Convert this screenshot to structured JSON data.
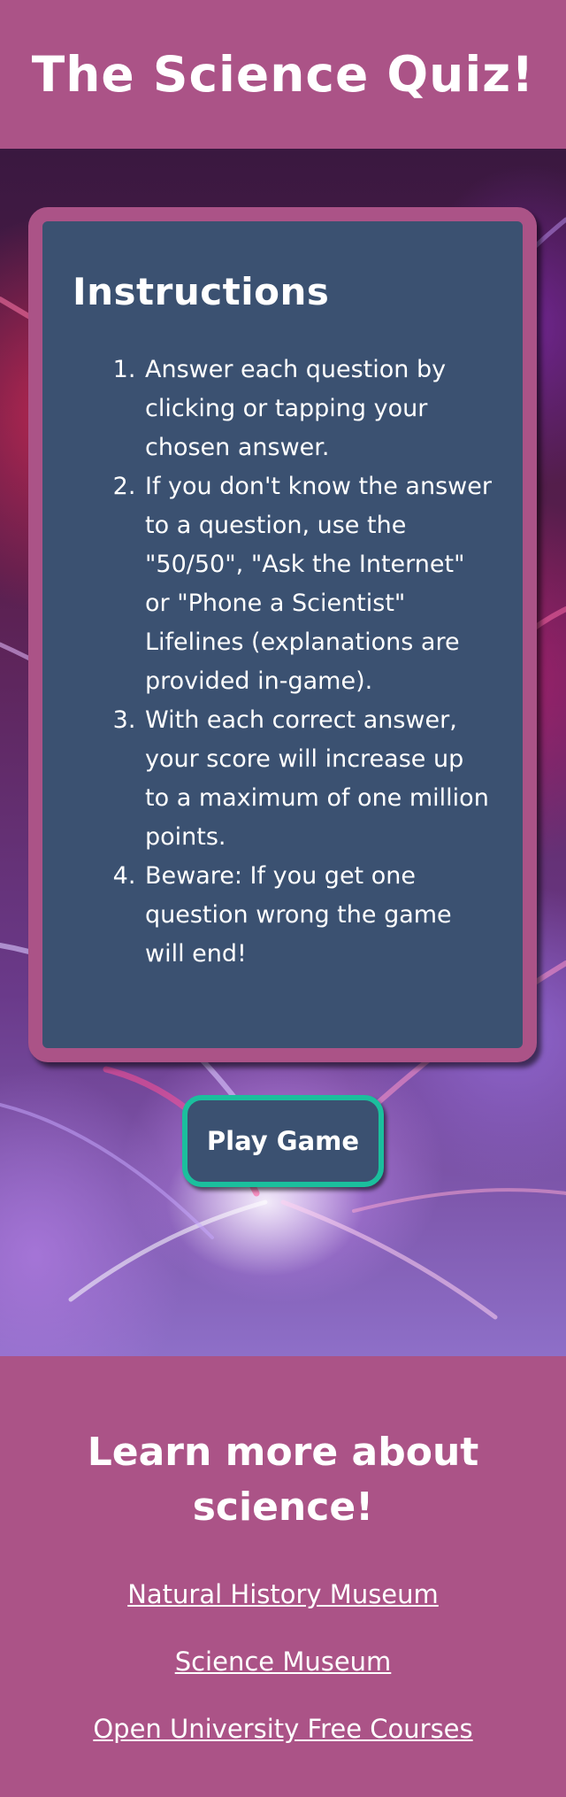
{
  "header": {
    "title": "The Science Quiz!"
  },
  "instructions": {
    "heading": "Instructions",
    "items": [
      "Answer each question by clicking or tapping your chosen answer.",
      "If you don't know the answer to a question, use the \"50/50\", \"Ask the Internet\" or \"Phone a Scientist\" Lifelines (explanations are provided in-game).",
      "With each correct answer, your score will increase up to a maximum of one million points.",
      "Beware: If you get one question wrong the game will end!"
    ]
  },
  "play_button": {
    "label": "Play Game"
  },
  "footer": {
    "heading": "Learn more about science!",
    "links": [
      "Natural History Museum",
      "Science Museum",
      "Open University Free Courses"
    ]
  },
  "colors": {
    "brand_pink": "#ab5387",
    "card_blue": "#3b5171",
    "button_border_teal": "#1bbf9d",
    "text": "#ffffff"
  }
}
